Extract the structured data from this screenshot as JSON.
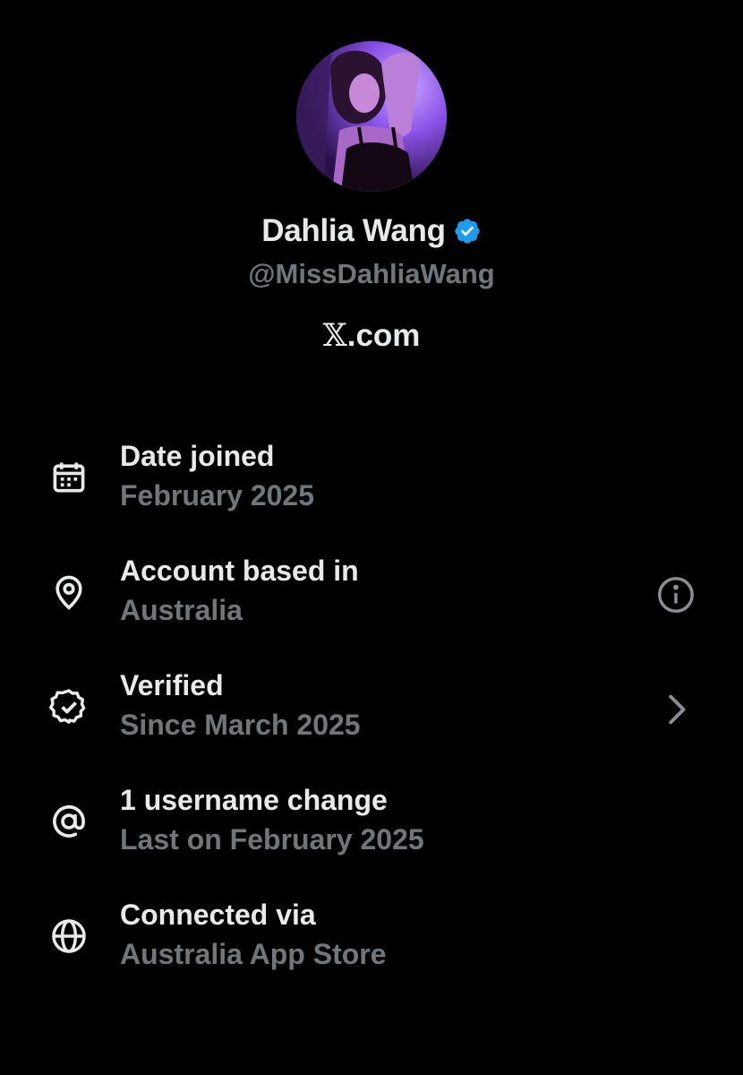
{
  "profile": {
    "display_name": "Dahlia Wang",
    "verified": true,
    "handle": "@MissDahliaWang",
    "site_logo": "𝕏",
    "site_domain": ".com",
    "avatar": "profile-photo"
  },
  "info_items": [
    {
      "icon": "calendar-icon",
      "title": "Date joined",
      "subtitle": "February 2025"
    },
    {
      "icon": "location-pin-icon",
      "title": "Account based in",
      "subtitle": "Australia",
      "action_icon": "info-icon"
    },
    {
      "icon": "verified-badge-icon",
      "title": "Verified",
      "subtitle": "Since March 2025",
      "action_icon": "chevron-right-icon"
    },
    {
      "icon": "at-sign-icon",
      "title": "1 username change",
      "subtitle": "Last on February 2025"
    },
    {
      "icon": "globe-icon",
      "title": "Connected via",
      "subtitle": "Australia App Store"
    }
  ],
  "colors": {
    "background": "#000000",
    "primary_text": "#e7e9ea",
    "secondary_text": "#71767b",
    "verified_blue": "#1d9bf0"
  }
}
